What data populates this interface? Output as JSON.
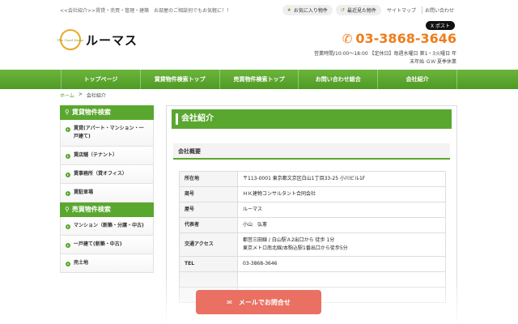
{
  "header": {
    "tagline": "<<会社紹介>>賃貸・売買・管理・建築　お部屋のご相談何でもお気軽に！！",
    "favorites_label": "お気に入り物件",
    "recent_label": "最近見た物件",
    "sitemap_label": "サイトマップ",
    "contact_label": "お問い合わせ",
    "logo_mark_text": "The Good Home",
    "logo_text": "ルーマス",
    "xpost_label": "X ポスト",
    "phone": "03-3868-3646",
    "hours_line1": "営業時間/10:00～18:00 【定休日】毎週水曜日 第1・3火曜日 年",
    "hours_line2": "末年始 ＧＷ 夏季休業"
  },
  "nav": {
    "items": [
      "トップページ",
      "賃貸物件検索トップ",
      "売買物件検索トップ",
      "お問い合わせ総合",
      "会社紹介"
    ]
  },
  "breadcrumb": {
    "home": "ホーム",
    "sep": ">",
    "current": "会社紹介"
  },
  "sidebar": {
    "rent_head": "賃貸物件検索",
    "rent_items": [
      "賃貸(アパート・マンション・一戸建て)",
      "賃店舗（テナント）",
      "賃事務所（貸オフィス）",
      "賃駐車場"
    ],
    "sale_head": "売買物件検索",
    "sale_items": [
      "マンション（新築・分譲・中古)",
      "一戸建て(新築・中古)",
      "売土地"
    ]
  },
  "main": {
    "title": "会社紹介",
    "subtitle": "会社概要",
    "rows": [
      {
        "k": "所在地",
        "v": "〒113-0001 東京都文京区白山1丁目33-25 小川ビル1F"
      },
      {
        "k": "商号",
        "v": "ＨＫ建物コンサルタント合同会社"
      },
      {
        "k": "屋号",
        "v": "ルーマス"
      },
      {
        "k": "代表者",
        "v": "小山　弘憲"
      },
      {
        "k": "交通アクセス",
        "v": "都営三田線 / 白山駅Ａ2出口から 徒歩 1分",
        "v2": "東京メトロ南北線/本駒込駅1番出口から徒歩5分"
      },
      {
        "k": "TEL",
        "v": "03-3868-3646"
      }
    ]
  },
  "mail_button": "メールでお問合せ",
  "colors": {
    "accent_green": "#5aa72f",
    "phone_orange": "#ee7d1c",
    "mail_red": "#e97062"
  }
}
